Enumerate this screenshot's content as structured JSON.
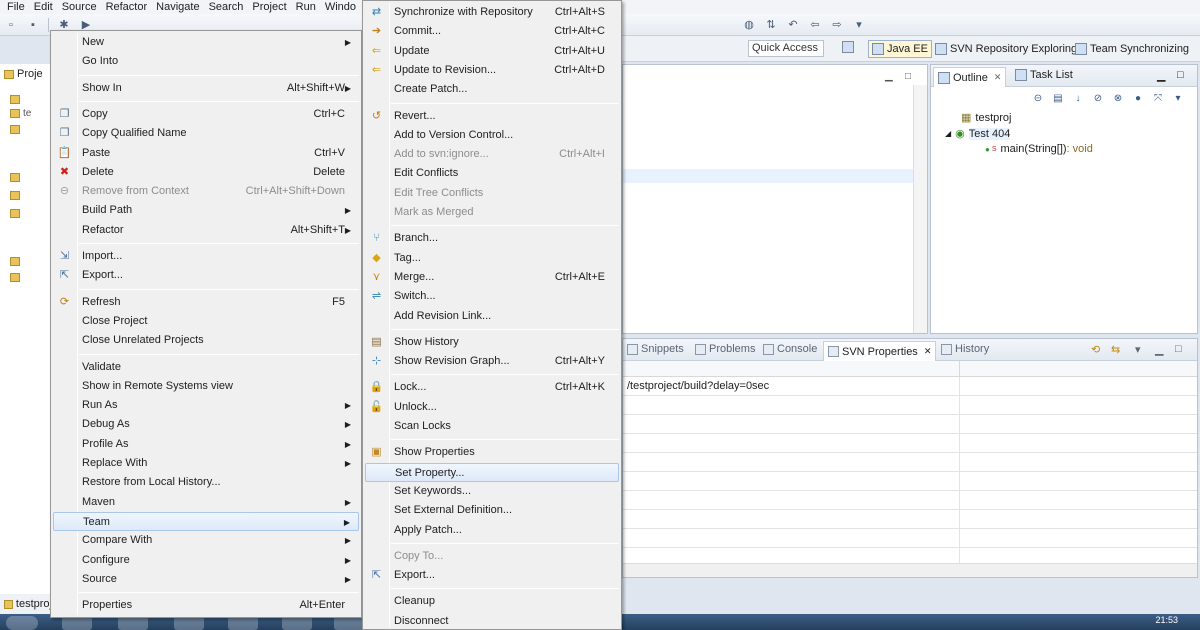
{
  "menubar": [
    "File",
    "Edit",
    "Source",
    "Refactor",
    "Navigate",
    "Search",
    "Project",
    "Run",
    "Windo"
  ],
  "perspectives": {
    "quick_access": "Quick Access",
    "java_ee": "Java EE",
    "svn": "SVN Repository Exploring",
    "team": "Team Synchronizing"
  },
  "explorer": {
    "tab": "Proje",
    "minimized_label": "testproj",
    "row_label": "te"
  },
  "outline": {
    "tabs": [
      "Outline",
      "Task List"
    ],
    "items": [
      {
        "label": "testproj",
        "icon": "package-icon"
      },
      {
        "label": "Test 404",
        "icon": "class-icon"
      },
      {
        "label": "main(String[])",
        "suffix": " : void",
        "icon": "method-icon"
      }
    ]
  },
  "bottom": {
    "tabs": [
      "Snippets",
      "Problems",
      "Console",
      "SVN Properties",
      "History"
    ],
    "rows": [
      "/testproject/build?delay=0sec",
      "",
      "",
      "",
      "",
      "",
      "",
      "",
      "",
      ""
    ]
  },
  "context_menu": {
    "items": [
      {
        "label": "New",
        "shortcut": "",
        "submenu": true
      },
      {
        "label": "Go Into",
        "shortcut": ""
      },
      {
        "sep": true
      },
      {
        "label": "Show In",
        "shortcut": "Alt+Shift+W",
        "submenu": true
      },
      {
        "sep": true
      },
      {
        "label": "Copy",
        "shortcut": "Ctrl+C",
        "icon": "copy-icon"
      },
      {
        "label": "Copy Qualified Name",
        "shortcut": "",
        "icon": "copy-icon"
      },
      {
        "label": "Paste",
        "shortcut": "Ctrl+V",
        "icon": "paste-icon"
      },
      {
        "label": "Delete",
        "shortcut": "Delete",
        "icon": "delete-icon"
      },
      {
        "label": "Remove from Context",
        "shortcut": "Ctrl+Alt+Shift+Down",
        "disabled": true,
        "icon": "remove-icon"
      },
      {
        "label": "Build Path",
        "shortcut": "",
        "submenu": true
      },
      {
        "label": "Refactor",
        "shortcut": "Alt+Shift+T",
        "submenu": true
      },
      {
        "sep": true
      },
      {
        "label": "Import...",
        "shortcut": "",
        "icon": "import-icon"
      },
      {
        "label": "Export...",
        "shortcut": "",
        "icon": "export-icon"
      },
      {
        "sep": true
      },
      {
        "label": "Refresh",
        "shortcut": "F5",
        "icon": "refresh-icon"
      },
      {
        "label": "Close Project",
        "shortcut": ""
      },
      {
        "label": "Close Unrelated Projects",
        "shortcut": ""
      },
      {
        "sep": true
      },
      {
        "label": "Validate",
        "shortcut": ""
      },
      {
        "label": "Show in Remote Systems view",
        "shortcut": ""
      },
      {
        "label": "Run As",
        "shortcut": "",
        "submenu": true
      },
      {
        "label": "Debug As",
        "shortcut": "",
        "submenu": true
      },
      {
        "label": "Profile As",
        "shortcut": "",
        "submenu": true
      },
      {
        "label": "Replace With",
        "shortcut": "",
        "submenu": true
      },
      {
        "label": "Restore from Local History...",
        "shortcut": ""
      },
      {
        "label": "Maven",
        "shortcut": "",
        "submenu": true
      },
      {
        "label": "Team",
        "shortcut": "",
        "submenu": true,
        "hover": true
      },
      {
        "label": "Compare With",
        "shortcut": "",
        "submenu": true
      },
      {
        "label": "Configure",
        "shortcut": "",
        "submenu": true
      },
      {
        "label": "Source",
        "shortcut": "",
        "submenu": true
      },
      {
        "sep": true
      },
      {
        "label": "Properties",
        "shortcut": "Alt+Enter"
      }
    ]
  },
  "team_menu": {
    "items": [
      {
        "label": "Synchronize with Repository",
        "shortcut": "Ctrl+Alt+S",
        "icon": "sync-icon"
      },
      {
        "label": "Commit...",
        "shortcut": "Ctrl+Alt+C",
        "icon": "commit-icon"
      },
      {
        "label": "Update",
        "shortcut": "Ctrl+Alt+U",
        "icon": "update-icon"
      },
      {
        "label": "Update to Revision...",
        "shortcut": "Ctrl+Alt+D",
        "icon": "update-icon"
      },
      {
        "label": "Create Patch...",
        "shortcut": ""
      },
      {
        "sep": true
      },
      {
        "label": "Revert...",
        "shortcut": "",
        "icon": "revert-icon"
      },
      {
        "label": "Add to Version Control...",
        "shortcut": ""
      },
      {
        "label": "Add to svn:ignore...",
        "shortcut": "Ctrl+Alt+I",
        "disabled": true
      },
      {
        "label": "Edit Conflicts",
        "shortcut": ""
      },
      {
        "label": "Edit Tree Conflicts",
        "shortcut": "",
        "disabled": true
      },
      {
        "label": "Mark as Merged",
        "shortcut": "",
        "disabled": true
      },
      {
        "sep": true
      },
      {
        "label": "Branch...",
        "shortcut": "",
        "icon": "branch-icon"
      },
      {
        "label": "Tag...",
        "shortcut": "",
        "icon": "tag-icon"
      },
      {
        "label": "Merge...",
        "shortcut": "Ctrl+Alt+E",
        "icon": "merge-icon"
      },
      {
        "label": "Switch...",
        "shortcut": "",
        "icon": "switch-icon"
      },
      {
        "label": "Add Revision Link...",
        "shortcut": ""
      },
      {
        "sep": true
      },
      {
        "label": "Show History",
        "shortcut": "",
        "icon": "history-icon"
      },
      {
        "label": "Show Revision Graph...",
        "shortcut": "Ctrl+Alt+Y",
        "icon": "graph-icon"
      },
      {
        "sep": true
      },
      {
        "label": "Lock...",
        "shortcut": "Ctrl+Alt+K",
        "icon": "lock-icon"
      },
      {
        "label": "Unlock...",
        "shortcut": "",
        "icon": "unlock-icon"
      },
      {
        "label": "Scan Locks",
        "shortcut": ""
      },
      {
        "sep": true
      },
      {
        "label": "Show Properties",
        "shortcut": "",
        "icon": "properties-icon"
      },
      {
        "label": "Set Property...",
        "shortcut": "",
        "hover": true
      },
      {
        "label": "Set Keywords...",
        "shortcut": ""
      },
      {
        "label": "Set External Definition...",
        "shortcut": ""
      },
      {
        "label": "Apply Patch...",
        "shortcut": ""
      },
      {
        "sep": true
      },
      {
        "label": "Copy To...",
        "shortcut": "",
        "disabled": true
      },
      {
        "label": "Export...",
        "shortcut": "",
        "icon": "export-icon"
      },
      {
        "sep": true
      },
      {
        "label": "Cleanup",
        "shortcut": ""
      },
      {
        "label": "Disconnect",
        "shortcut": ""
      }
    ]
  },
  "clock": "21:53",
  "colors": {
    "menu_bg": "#f0f0f0",
    "hover_border": "#a9c6ee",
    "disabled": "#8d8d8d"
  }
}
